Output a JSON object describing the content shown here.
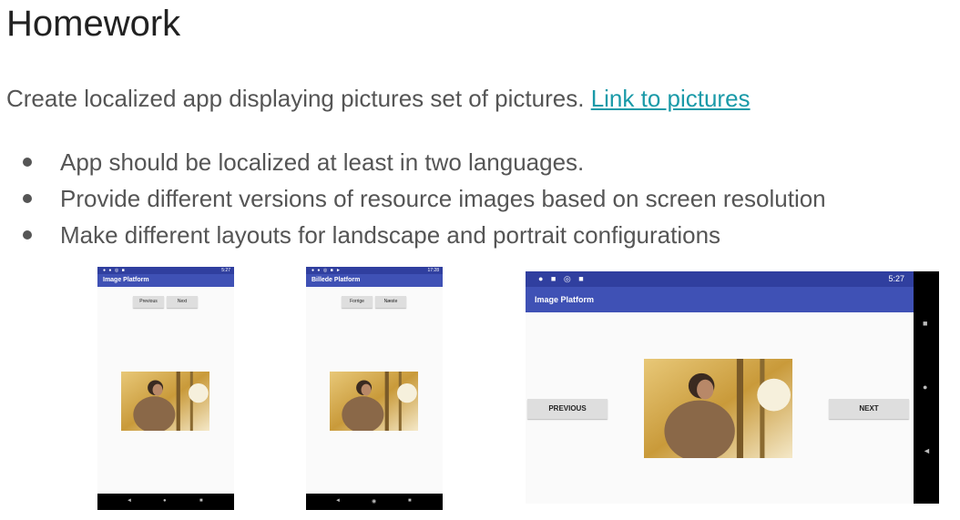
{
  "slide": {
    "title": "Homework",
    "intro_text": "Create localized app displaying pictures set of pictures.",
    "intro_link": "Link to pictures",
    "bullets": [
      "App should be localized at least in two languages.",
      "Provide different versions of resource images based on screen resolution",
      "Make different layouts for landscape and portrait configurations"
    ]
  },
  "phones": {
    "english_portrait": {
      "status_time": "5:27",
      "app_title": "Image Platform",
      "prev_label": "Previous",
      "next_label": "Next",
      "nav_icons": [
        "◄",
        "●",
        "■"
      ]
    },
    "danish_portrait": {
      "status_time": "17:28",
      "app_title": "Billede Platform",
      "prev_label": "Forrige",
      "next_label": "Næste",
      "nav_icons": [
        "◄",
        "◉",
        "■"
      ]
    },
    "landscape": {
      "status_time": "5:27",
      "app_title": "Image Platform",
      "prev_label": "PREVIOUS",
      "next_label": "NEXT",
      "nav_icons": [
        "■",
        "●",
        "◄"
      ]
    }
  },
  "colors": {
    "status_bar": "#303f9f",
    "app_bar": "#3f51b5",
    "link": "#1a9aa8"
  }
}
